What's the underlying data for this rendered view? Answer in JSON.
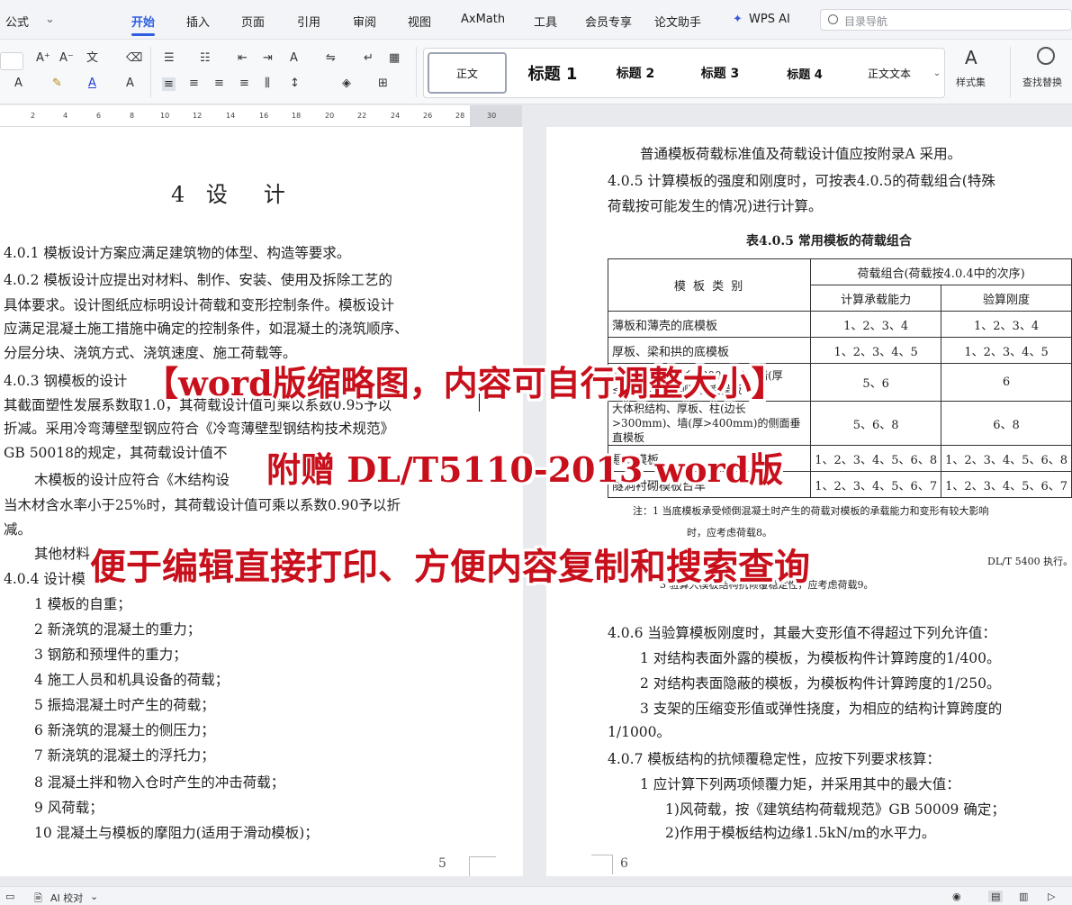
{
  "menubar": {
    "font_label": "公式",
    "tabs": [
      "开始",
      "插入",
      "页面",
      "引用",
      "审阅",
      "视图",
      "AxMath",
      "工具",
      "会员专享",
      "论文助手",
      "WPS AI"
    ],
    "search_placeholder": "目录导航"
  },
  "ribbon": {
    "styles": [
      "正文",
      "标题 1",
      "标题 2",
      "标题 3",
      "标题 4",
      "正文文本"
    ],
    "styles_set_label": "样式集",
    "find_replace_label": "查找替换"
  },
  "ruler": {
    "ticks": [
      "2",
      "4",
      "6",
      "8",
      "10",
      "12",
      "14",
      "16",
      "18",
      "20",
      "22",
      "24",
      "26",
      "28",
      "30"
    ]
  },
  "left_page": {
    "title": "4 设　计",
    "lines": [
      "4.0.1  模板设计方案应满足建筑物的体型、构造等要求。",
      "4.0.2   模板设计应提出对材料、制作、安装、使用及拆除工艺的",
      "具体要求。设计图纸应标明设计荷载和变形控制条件。模板设计",
      "应满足混凝土施工措施中确定的控制条件，如混凝土的浇筑顺序、",
      "分层分块、浇筑方式、浇筑速度、施工荷载等。",
      "4.0.3   钢模板的设计",
      "其截面塑性发展系数取1.0，其荷载设计值可乘以系数0.95予以",
      "折减。采用冷弯薄壁型钢应符合《冷弯薄壁型钢结构技术规范》",
      "GB 50018的规定，其荷载设计值不",
      "木模板的设计应符合《木结构设",
      "当木材含水率小于25%时，其荷载设计值可乘以系数0.90予以折",
      "减。",
      "其他材料",
      "4.0.4   设计模"
    ],
    "list": [
      "1   模板的自重；",
      "2   新浇筑的混凝土的重力；",
      "3   钢筋和预埋件的重力；",
      "4   施工人员和机具设备的荷载；",
      "5   振捣混凝土时产生的荷载；",
      "6   新浇筑的混凝土的侧压力；",
      "7   新浇筑的混凝土的浮托力；",
      "8   混凝土拌和物入仓时产生的冲击荷载；",
      "9   风荷载；",
      "10   混凝土与模板的摩阻力(适用于滑动模板)；"
    ],
    "page_number": "5"
  },
  "right_page": {
    "lines_top": [
      "普通模板荷载标准值及荷载设计值应按附录A 采用。",
      "4.0.5  计算模板的强度和刚度时，可按表4.0.5的荷载组合(特殊",
      "荷载按可能发生的情况)进行计算。"
    ],
    "table_caption": "表4.0.5  常用模板的荷载组合",
    "table": {
      "header_type": "模 板 类 别",
      "header_combo": "荷载组合(荷载按4.0.4中的次序)",
      "header_capacity": "计算承载能力",
      "header_stiffness": "验算刚度",
      "rows": [
        {
          "type": "薄板和薄壳的底模板",
          "capacity": "1、2、3、4",
          "stiffness": "1、2、3、4"
        },
        {
          "type": "厚板、梁和拱的底模板",
          "capacity": "1、2、3、4、5",
          "stiffness": "1、2、3、4、5"
        },
        {
          "type": "梁、拱、柱(边长≤300mm)、墙(厚≤400mm)的侧面垂直模板",
          "capacity": "5、6",
          "stiffness": "6"
        },
        {
          "type": "大体积结构、厚板、柱(边长>300mm)、墙(厚>400mm)的侧面垂直模板",
          "capacity": "5、6、8",
          "stiffness": "6、8"
        },
        {
          "type": "悬臂模板",
          "capacity": "1、2、3、4、5、6、8",
          "stiffness": "1、2、3、4、5、6、8"
        },
        {
          "type": "隧洞衬砌模板台车",
          "capacity": "1、2、3、4、5、6、7",
          "stiffness": "1、2、3、4、5、6、7"
        }
      ]
    },
    "notes": [
      "注：1   当底模板承受倾倒混凝土时产生的荷载对模板的承载能力和变形有较大影响",
      "时，应考虑荷载8。",
      "DL/T 5400 执行。",
      "3   验算大模板结构抗倾覆稳定性，应考虑荷载9。"
    ],
    "lines_bottom": [
      "4.0.6  当验算模板刚度时，其最大变形值不得超过下列允许值：",
      "1   对结构表面外露的模板，为模板构件计算跨度的1/400。",
      "2   对结构表面隐蔽的模板，为模板构件计算跨度的1/250。",
      "3   支架的压缩变形值或弹性挠度，为相应的结构计算跨度的",
      "1/1000。",
      "4.0.7  模板结构的抗倾覆稳定性，应按下列要求核算：",
      "1   应计算下列两项倾覆力矩，并采用其中的最大值：",
      "1)风荷载，按《建筑结构荷载规范》GB 50009 确定；",
      "2)作用于模板结构边缘1.5kN/m的水平力。"
    ],
    "page_number": "6"
  },
  "watermark": {
    "line1": "【word版缩略图，内容可自行调整大小】",
    "line2": "附赠 DL/T5110-2013 word版",
    "line3": "便于编辑直接打印、方便内容复制和搜索查询"
  },
  "statusbar": {
    "ai_check": "AI 校对"
  },
  "colors": {
    "accent": "#2f5fe0",
    "watermark_red": "#c8101c"
  }
}
